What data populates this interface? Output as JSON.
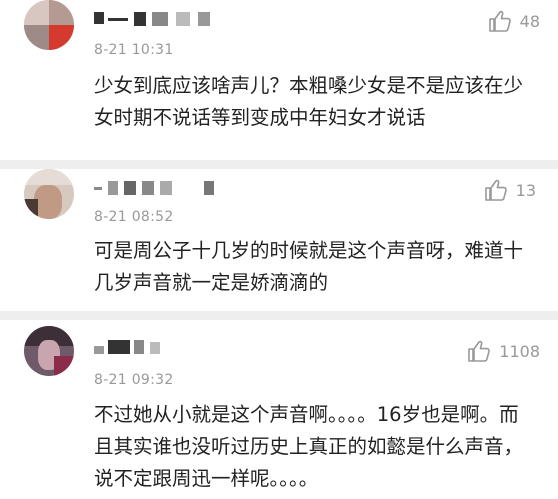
{
  "comments": [
    {
      "time": "8-21 10:31",
      "likes": "48",
      "text": "少女到底应该啥声儿？本粗嗓少女是不是应该在少女时期不说话等到变成中年妇女才说话"
    },
    {
      "time": "8-21 08:52",
      "likes": "13",
      "text": "可是周公子十几岁的时候就是这个声音呀，难道十几岁声音就一定是娇滴滴的"
    },
    {
      "time": "8-21 09:32",
      "likes": "1108",
      "text": "不过她从小就是这个声音啊。。。。16岁也是啊。而且其实谁也没听过历史上真正的如懿是什么声音，说不定跟周迅一样呢。。。。"
    }
  ],
  "icons": {
    "like": "thumbs-up-icon"
  }
}
